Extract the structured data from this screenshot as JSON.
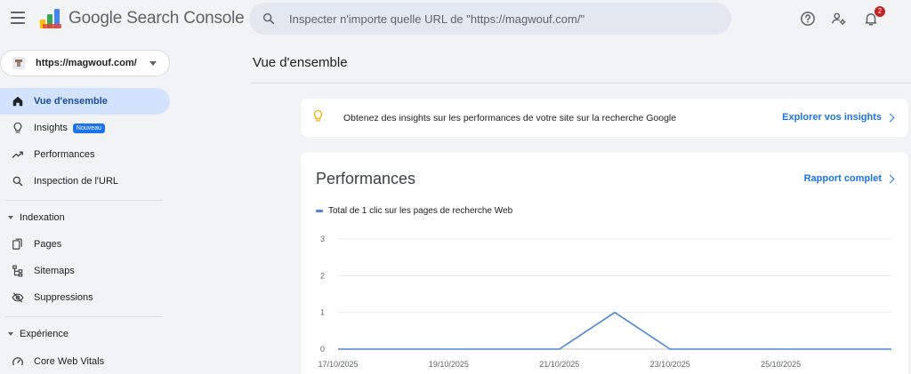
{
  "header": {
    "brand": "Google Search Console",
    "search_placeholder": "Inspecter n'importe quelle URL de \"https://magwouf.com/\"",
    "notification_count": "2",
    "icons": [
      "menu-icon",
      "help-icon",
      "manage-users-icon",
      "bell-icon",
      "search-icon"
    ]
  },
  "sidebar": {
    "property": "https://magwouf.com/",
    "items": [
      {
        "label": "Vue d'ensemble",
        "icon": "home-icon",
        "active": true
      },
      {
        "label": "Insights",
        "icon": "lightbulb-icon",
        "badge": "Nouveau"
      },
      {
        "label": "Performances",
        "icon": "trending-up-icon"
      },
      {
        "label": "Inspection de l'URL",
        "icon": "search-icon"
      }
    ],
    "indexation": {
      "label": "Indexation",
      "items": [
        {
          "label": "Pages",
          "icon": "pages-icon"
        },
        {
          "label": "Sitemaps",
          "icon": "sitemap-icon"
        },
        {
          "label": "Suppressions",
          "icon": "eye-off-icon"
        }
      ]
    },
    "experience": {
      "label": "Expérience",
      "items": [
        {
          "label": "Core Web Vitals",
          "icon": "gauge-icon"
        }
      ]
    }
  },
  "main": {
    "title": "Vue d'ensemble",
    "insight": {
      "text": "Obtenez des insights sur les performances de votre site sur la recherche Google",
      "link": "Explorer vos insights"
    },
    "performance": {
      "title": "Performances",
      "link": "Rapport complet",
      "legend": "Total de 1 clic sur les pages de recherche Web"
    }
  },
  "colors": {
    "accent": "#1a73e8",
    "active_bg": "#d3e3fd",
    "series": "#4e86d6"
  },
  "chart_data": {
    "type": "line",
    "x": [
      "17/10/2025",
      "18/10/2025",
      "19/10/2025",
      "20/10/2025",
      "21/10/2025",
      "22/10/2025",
      "23/10/2025",
      "24/10/2025",
      "25/10/2025",
      "26/10/2025",
      "27/10/2025"
    ],
    "x_tick_labels": [
      "17/10/2025",
      "19/10/2025",
      "21/10/2025",
      "23/10/2025",
      "25/10/2025"
    ],
    "series": [
      {
        "name": "Total de 1 clic sur les pages de recherche Web",
        "values": [
          0,
          0,
          0,
          0,
          0,
          1,
          0,
          0,
          0,
          0,
          0
        ]
      }
    ],
    "y_ticks": [
      0,
      1,
      2,
      3
    ],
    "ylim": [
      0,
      3
    ],
    "grid": true,
    "legend": "top-left"
  }
}
